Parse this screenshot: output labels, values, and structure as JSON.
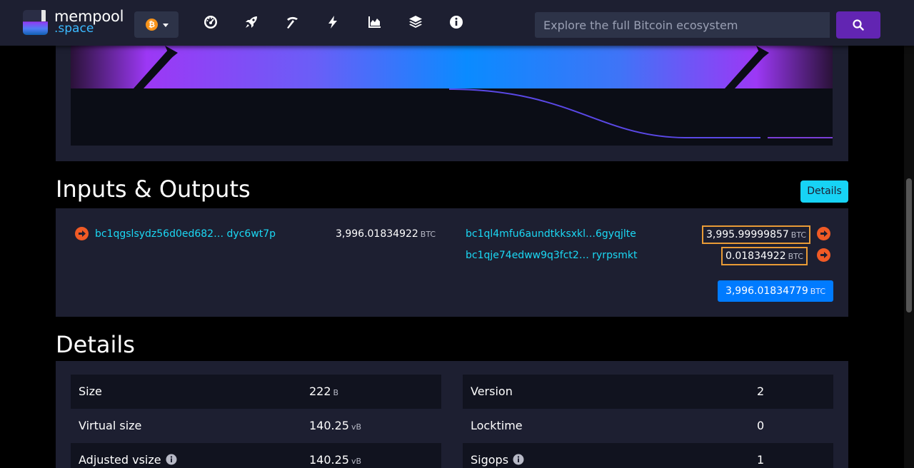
{
  "nav": {
    "logo_line1": "mempool",
    "logo_line2": ".space",
    "network_symbol": "₿",
    "icons": [
      "dashboard-icon",
      "rocket-icon",
      "mining-pick-icon",
      "lightning-icon",
      "graphs-icon",
      "layers-icon",
      "info-icon"
    ],
    "search_placeholder": "Explore the full Bitcoin ecosystem"
  },
  "colors": {
    "nav_bg": "#1d1f31",
    "link": "#1bd8f4",
    "search_btn": "#6225b2",
    "details_btn": "#17d3f5",
    "total_btn": "#007bff",
    "highlight_border": "#e99b36",
    "arrow_red": "#f05a25"
  },
  "io": {
    "heading": "Inputs & Outputs",
    "details_button": "Details",
    "inputs": [
      {
        "address": "bc1qgslsydz56d0ed682… dyc6wt7p",
        "amount": "3,996.01834922",
        "unit": "BTC"
      }
    ],
    "outputs": [
      {
        "address": "bc1ql4mfu6aundtkksxkl…6gyqjlte",
        "amount": "3,995.99999857",
        "unit": "BTC"
      },
      {
        "address": "bc1qje74edww9q3fct2… ryrpsmkt",
        "amount": "0.01834922",
        "unit": "BTC"
      }
    ],
    "total_amount": "3,996.01834779",
    "total_unit": "BTC"
  },
  "details": {
    "heading": "Details",
    "left": [
      {
        "label": "Size",
        "value": "222",
        "unit": "B"
      },
      {
        "label": "Virtual size",
        "value": "140.25",
        "unit": "vB"
      },
      {
        "label": "Adjusted vsize",
        "value": "140.25",
        "unit": "vB",
        "info": true
      }
    ],
    "right": [
      {
        "label": "Version",
        "value": "2"
      },
      {
        "label": "Locktime",
        "value": "0"
      },
      {
        "label": "Sigops",
        "value": "1",
        "info": true
      }
    ]
  }
}
